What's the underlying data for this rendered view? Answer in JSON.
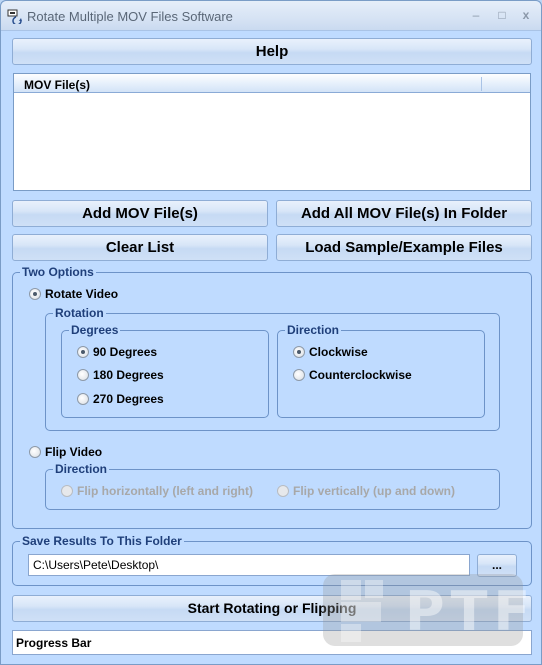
{
  "window": {
    "title": "Rotate Multiple MOV Files Software",
    "app_icon": "rotate-app-icon",
    "controls": {
      "minimize": "–",
      "maximize": "□",
      "close": "x"
    }
  },
  "toolbar": {
    "help_label": "Help"
  },
  "file_list": {
    "columns": [
      "MOV File(s)"
    ],
    "rows": []
  },
  "buttons": {
    "add_files": "Add MOV File(s)",
    "add_folder": "Add All MOV File(s) In Folder",
    "clear_list": "Clear List",
    "load_sample": "Load Sample/Example Files",
    "browse": "...",
    "start": "Start Rotating or Flipping"
  },
  "options": {
    "group_label": "Two Options",
    "rotate_video": {
      "label": "Rotate Video",
      "checked": true
    },
    "rotation": {
      "group_label": "Rotation",
      "degrees": {
        "group_label": "Degrees",
        "items": [
          {
            "label": "90 Degrees",
            "checked": true
          },
          {
            "label": "180 Degrees",
            "checked": false
          },
          {
            "label": "270 Degrees",
            "checked": false
          }
        ]
      },
      "direction": {
        "group_label": "Direction",
        "items": [
          {
            "label": "Clockwise",
            "checked": true
          },
          {
            "label": "Counterclockwise",
            "checked": false
          }
        ]
      }
    },
    "flip_video": {
      "label": "Flip Video",
      "checked": false
    },
    "flip_direction": {
      "group_label": "Direction",
      "items": [
        {
          "label": "Flip horizontally (left and right)",
          "checked": false,
          "disabled": true
        },
        {
          "label": "Flip vertically (up and down)",
          "checked": false,
          "disabled": true
        }
      ]
    }
  },
  "output": {
    "group_label": "Save Results To This Folder",
    "folder_value": "C:\\Users\\Pete\\Desktop\\"
  },
  "progress": {
    "label": "Progress Bar"
  },
  "watermark": {
    "text": "PTF"
  }
}
